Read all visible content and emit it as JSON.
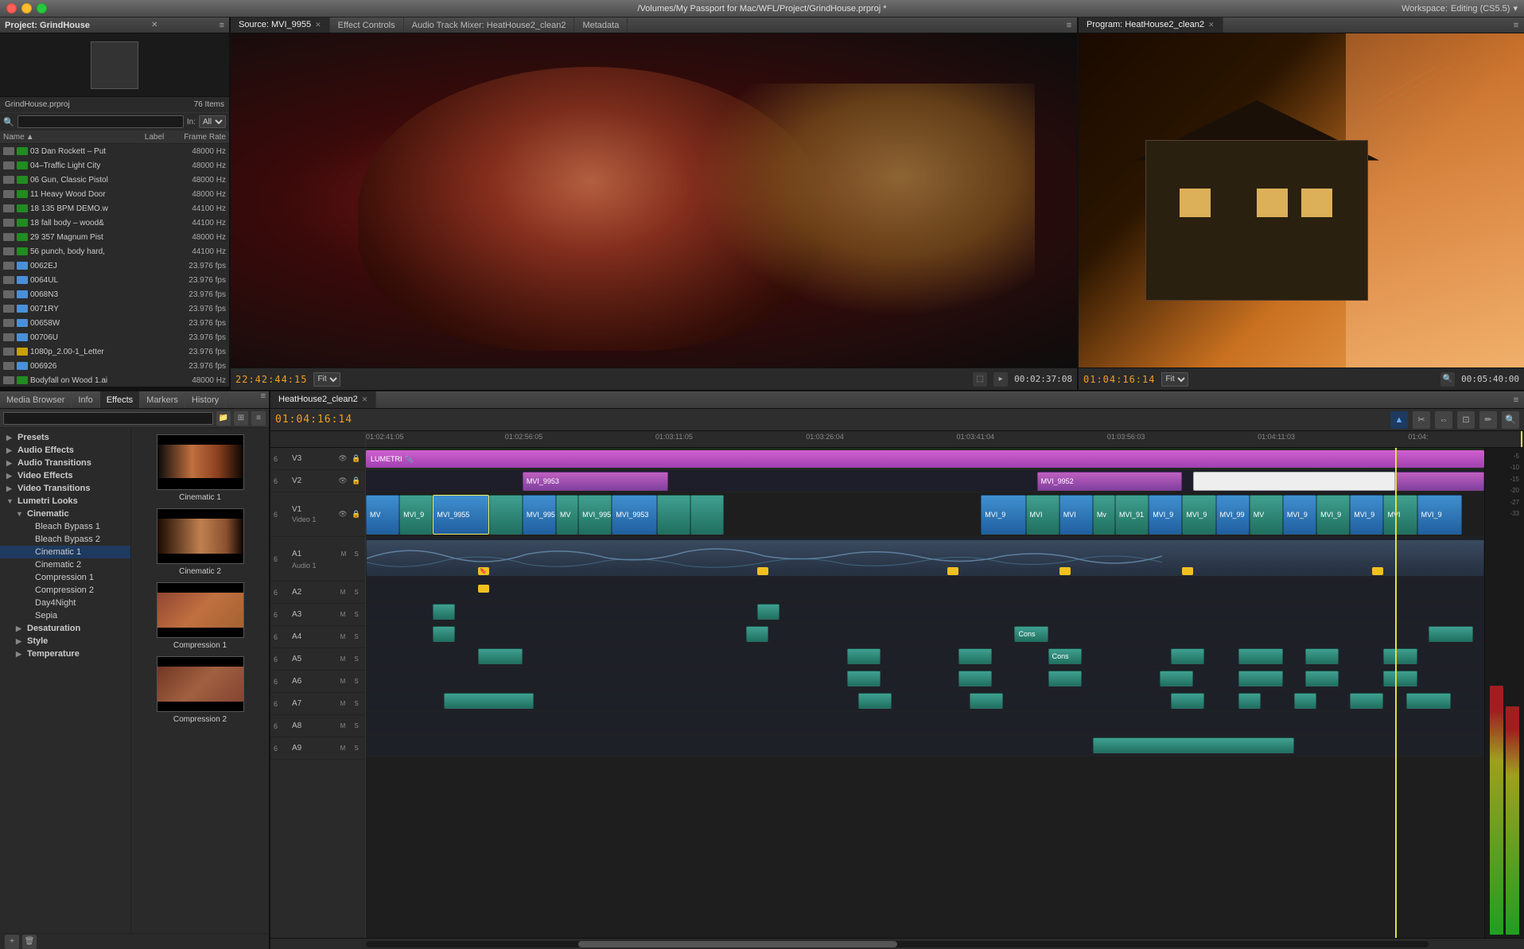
{
  "titlebar": {
    "title": "/Volumes/My Passport for Mac/WFL/Project/GrindHouse.prproj *",
    "workspace_label": "Workspace:",
    "workspace_value": "Editing (CS5.5)"
  },
  "project": {
    "title": "Project: GrindHouse",
    "filename": "GrindHouse.prproj",
    "item_count": "76 Items",
    "search_placeholder": "",
    "in_label": "In:",
    "in_value": "All",
    "columns": {
      "name": "Name",
      "label": "Label",
      "framerate": "Frame Rate"
    },
    "items": [
      {
        "type": "audio",
        "color": "#228b22",
        "name": "03 Dan Rockett – Put",
        "framerate": "48000 Hz"
      },
      {
        "type": "audio",
        "color": "#228b22",
        "name": "04–Traffic Light City",
        "framerate": "48000 Hz"
      },
      {
        "type": "audio",
        "color": "#228b22",
        "name": "06 Gun, Classic Pistol",
        "framerate": "48000 Hz"
      },
      {
        "type": "audio",
        "color": "#228b22",
        "name": "11 Heavy Wood Door",
        "framerate": "48000 Hz"
      },
      {
        "type": "audio",
        "color": "#228b22",
        "name": "18 135 BPM DEMO.w",
        "framerate": "44100 Hz"
      },
      {
        "type": "audio",
        "color": "#228b22",
        "name": "18 fall body – wood&",
        "framerate": "44100 Hz"
      },
      {
        "type": "audio",
        "color": "#228b22",
        "name": "29 357 Magnum Pist",
        "framerate": "48000 Hz"
      },
      {
        "type": "audio",
        "color": "#228b22",
        "name": "56 punch, body hard,",
        "framerate": "44100 Hz"
      },
      {
        "type": "video",
        "color": "#4a90d9",
        "name": "0062EJ",
        "framerate": "23.976 fps"
      },
      {
        "type": "video",
        "color": "#4a90d9",
        "name": "0064UL",
        "framerate": "23.976 fps"
      },
      {
        "type": "video",
        "color": "#4a90d9",
        "name": "0068N3",
        "framerate": "23.976 fps"
      },
      {
        "type": "video",
        "color": "#4a90d9",
        "name": "0071RY",
        "framerate": "23.976 fps"
      },
      {
        "type": "video",
        "color": "#4a90d9",
        "name": "00658W",
        "framerate": "23.976 fps"
      },
      {
        "type": "video",
        "color": "#4a90d9",
        "name": "00706U",
        "framerate": "23.976 fps"
      },
      {
        "type": "still",
        "color": "#c8a000",
        "name": "1080p_2.00-1_Letter",
        "framerate": "23.976 fps"
      },
      {
        "type": "audio",
        "color": "#228b22",
        "name": "006926",
        "framerate": "23.976 fps"
      },
      {
        "type": "audio",
        "color": "#228b22",
        "name": "Bodyfall on Wood 1.ai",
        "framerate": "48000 Hz"
      }
    ]
  },
  "source_panel": {
    "tabs": [
      {
        "label": "Source: MVI_9955",
        "active": true
      },
      {
        "label": "Effect Controls",
        "active": false
      },
      {
        "label": "Audio Track Mixer: HeatHouse2_clean2",
        "active": false
      },
      {
        "label": "Metadata",
        "active": false
      }
    ],
    "timecode": "22:42:44:15",
    "fit": "Fit",
    "duration": "00:02:37:08"
  },
  "program_panel": {
    "title": "Program: HeatHouse2_clean2",
    "timecode": "01:04:16:14",
    "fit": "Fit",
    "duration": "00:05:40:00"
  },
  "effects": {
    "tabs": [
      {
        "label": "Media Browser"
      },
      {
        "label": "Info"
      },
      {
        "label": "Effects",
        "active": true
      },
      {
        "label": "Markers"
      },
      {
        "label": "History"
      }
    ],
    "tree": [
      {
        "label": "Presets",
        "indent": 0,
        "expanded": true
      },
      {
        "label": "Audio Effects",
        "indent": 0,
        "expanded": true
      },
      {
        "label": "Audio Transitions",
        "indent": 0,
        "expanded": false
      },
      {
        "label": "Video Effects",
        "indent": 0,
        "expanded": false
      },
      {
        "label": "Video Transitions",
        "indent": 0,
        "expanded": false
      },
      {
        "label": "Lumetri Looks",
        "indent": 0,
        "expanded": true
      },
      {
        "label": "Cinematic",
        "indent": 1,
        "expanded": true
      },
      {
        "label": "Bleach Bypass 1",
        "indent": 2,
        "expanded": false
      },
      {
        "label": "Bleach Bypass 2",
        "indent": 2,
        "expanded": false
      },
      {
        "label": "Cinematic 1",
        "indent": 2,
        "expanded": false,
        "selected": true
      },
      {
        "label": "Cinematic 2",
        "indent": 2,
        "expanded": false
      },
      {
        "label": "Compression 1",
        "indent": 2,
        "expanded": false
      },
      {
        "label": "Compression 2",
        "indent": 2,
        "expanded": false
      },
      {
        "label": "Day4Night",
        "indent": 2,
        "expanded": false
      },
      {
        "label": "Sepia",
        "indent": 2,
        "expanded": false
      },
      {
        "label": "Desaturation",
        "indent": 1,
        "expanded": false
      },
      {
        "label": "Style",
        "indent": 1,
        "expanded": false
      },
      {
        "label": "Temperature",
        "indent": 1,
        "expanded": false
      }
    ],
    "previews": [
      {
        "label": "Cinematic 1",
        "class": "prev-cinematic1"
      },
      {
        "label": "Cinematic 2",
        "class": "prev-cinematic2"
      },
      {
        "label": "Compression 1",
        "class": "prev-compression1"
      },
      {
        "label": "Compression 2",
        "class": "prev-compression2"
      }
    ]
  },
  "timeline": {
    "tab_label": "HeatHouse2_clean2",
    "timecode": "01:04:16:14",
    "tools": [
      "arrow",
      "razor",
      "slip",
      "slide",
      "pen",
      "zoom"
    ],
    "ruler_marks": [
      "01:02:41:05",
      "01:02:56:05",
      "01:03:11:05",
      "01:03:26:04",
      "01:03:41:04",
      "01:03:56:03",
      "01:04:11:03",
      "01:04:"
    ],
    "tracks": [
      {
        "id": "V3",
        "type": "video",
        "name": ""
      },
      {
        "id": "V2",
        "type": "video",
        "name": ""
      },
      {
        "id": "V1",
        "type": "video",
        "name": "Video 1",
        "tall": true
      },
      {
        "id": "A1",
        "type": "audio",
        "name": "Audio 1",
        "tall": true
      },
      {
        "id": "A2",
        "type": "audio",
        "name": ""
      },
      {
        "id": "A3",
        "type": "audio",
        "name": ""
      },
      {
        "id": "A4",
        "type": "audio",
        "name": ""
      },
      {
        "id": "A5",
        "type": "audio",
        "name": ""
      },
      {
        "id": "A6",
        "type": "audio",
        "name": ""
      },
      {
        "id": "A7",
        "type": "audio",
        "name": ""
      },
      {
        "id": "A8",
        "type": "audio",
        "name": ""
      },
      {
        "id": "A9",
        "type": "audio",
        "name": ""
      }
    ]
  },
  "audio_meters": {
    "labels": [
      "-5",
      "-10",
      "-15",
      "-20",
      "-27",
      "-33"
    ]
  }
}
